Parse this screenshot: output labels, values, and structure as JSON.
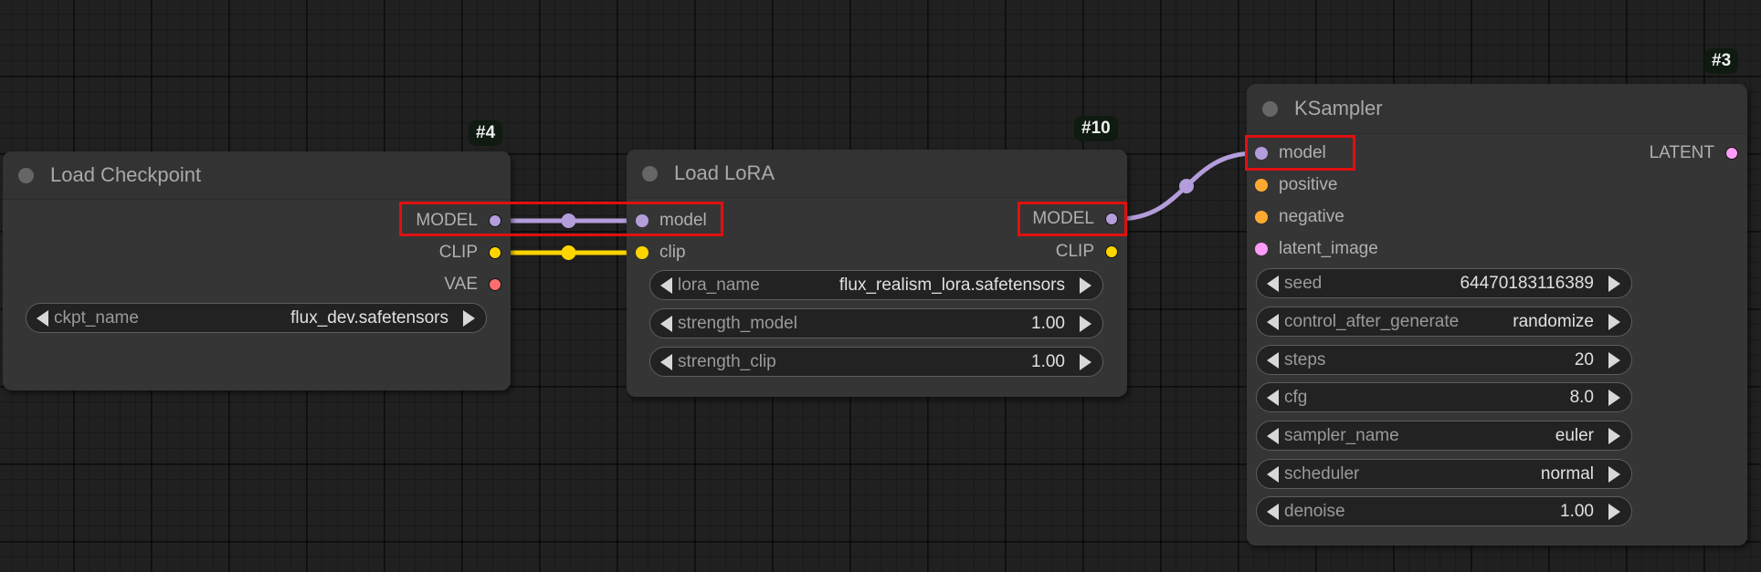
{
  "canvas": {
    "app": "ComfyUI node graph"
  },
  "colors": {
    "model": "#b39ddb",
    "clip": "#ffd500",
    "vae": "#ff6e6e",
    "conditioning": "#ffa931",
    "latent": "#ff9cf9",
    "highlight": "#e01010"
  },
  "nodes": {
    "checkpoint": {
      "id_badge": "#4",
      "title": "Load Checkpoint",
      "outputs": [
        {
          "label": "MODEL",
          "type": "model"
        },
        {
          "label": "CLIP",
          "type": "clip"
        },
        {
          "label": "VAE",
          "type": "vae"
        }
      ],
      "widgets": [
        {
          "label": "ckpt_name",
          "value": "flux_dev.safetensors"
        }
      ]
    },
    "lora": {
      "id_badge": "#10",
      "title": "Load LoRA",
      "inputs": [
        {
          "label": "model",
          "type": "model"
        },
        {
          "label": "clip",
          "type": "clip"
        }
      ],
      "outputs": [
        {
          "label": "MODEL",
          "type": "model"
        },
        {
          "label": "CLIP",
          "type": "clip"
        }
      ],
      "widgets": [
        {
          "label": "lora_name",
          "value": "flux_realism_lora.safetensors"
        },
        {
          "label": "strength_model",
          "value": "1.00"
        },
        {
          "label": "strength_clip",
          "value": "1.00"
        }
      ]
    },
    "ksampler": {
      "id_badge": "#3",
      "title": "KSampler",
      "inputs": [
        {
          "label": "model",
          "type": "model"
        },
        {
          "label": "positive",
          "type": "conditioning"
        },
        {
          "label": "negative",
          "type": "conditioning"
        },
        {
          "label": "latent_image",
          "type": "latent"
        }
      ],
      "outputs": [
        {
          "label": "LATENT",
          "type": "latent"
        }
      ],
      "widgets": [
        {
          "label": "seed",
          "value": "64470183116389"
        },
        {
          "label": "control_after_generate",
          "value": "randomize"
        },
        {
          "label": "steps",
          "value": "20"
        },
        {
          "label": "cfg",
          "value": "8.0"
        },
        {
          "label": "sampler_name",
          "value": "euler"
        },
        {
          "label": "scheduler",
          "value": "normal"
        },
        {
          "label": "denoise",
          "value": "1.00"
        }
      ]
    }
  },
  "links": [
    {
      "from": "checkpoint.MODEL",
      "to": "lora.model",
      "type": "model"
    },
    {
      "from": "checkpoint.CLIP",
      "to": "lora.clip",
      "type": "clip"
    },
    {
      "from": "lora.MODEL",
      "to": "ksampler.model",
      "type": "model"
    }
  ]
}
